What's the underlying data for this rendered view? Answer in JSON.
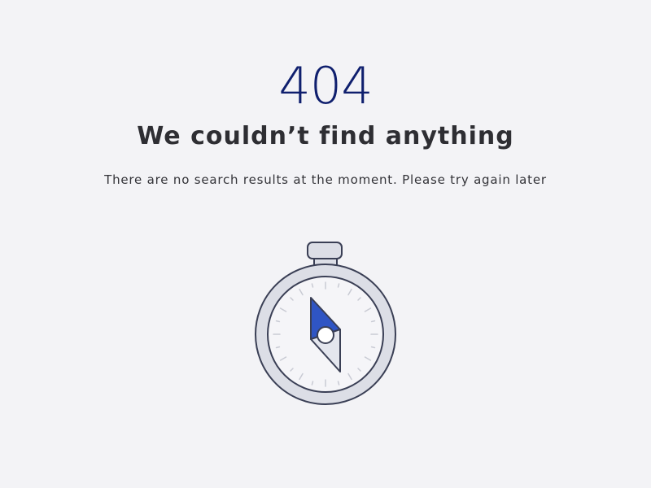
{
  "error": {
    "code": "404",
    "title": "We couldn’t find anything",
    "message": "There are no search results at the moment. Please try again later"
  },
  "illustration": {
    "icon": "stopwatch-compass-icon",
    "colors": {
      "outline": "#3a3f55",
      "ring": "#dcdee6",
      "face": "#f5f5f8",
      "needle_accent": "#2f55c4",
      "needle_light": "#e4e6ee"
    }
  },
  "theme": {
    "background": "#f3f3f6",
    "code_color": "#0f1f6e",
    "text_color": "#2e2e33"
  }
}
